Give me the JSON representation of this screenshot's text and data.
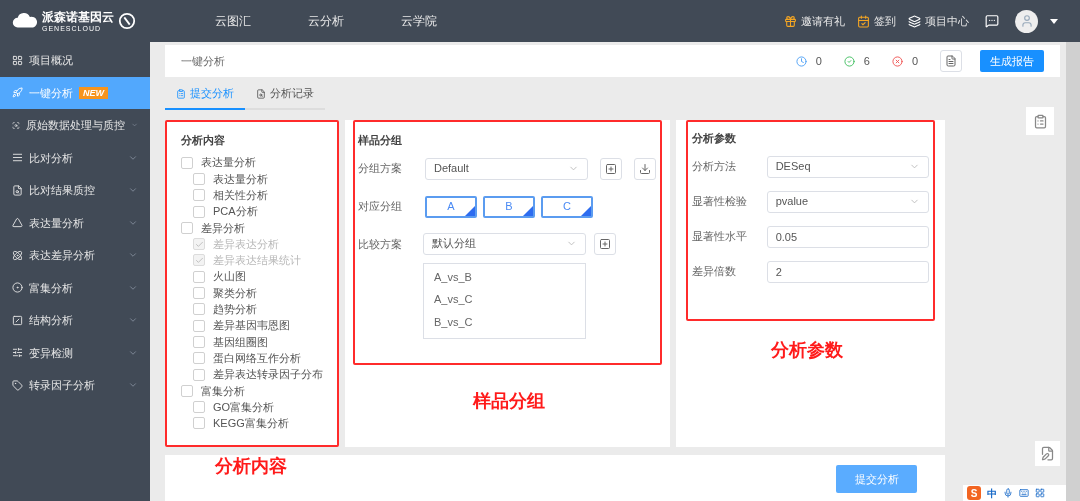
{
  "logo": {
    "name": "派森诺基因云",
    "subtitle": "GENESCLOUD"
  },
  "nav": [
    {
      "label": "云图汇"
    },
    {
      "label": "云分析"
    },
    {
      "label": "云学院"
    }
  ],
  "user_menu": [
    {
      "kind": "gift",
      "label": "邀请有礼"
    },
    {
      "kind": "sign",
      "label": "签到"
    },
    {
      "kind": "layers",
      "label": "项目中心"
    }
  ],
  "sidebar": [
    {
      "label": "项目概况",
      "selected": false,
      "expandable": false
    },
    {
      "label": "一键分析",
      "selected": true,
      "expandable": false,
      "badge": "NEW"
    },
    {
      "label": "原始数据处理与质控",
      "selected": false,
      "expandable": true
    },
    {
      "label": "比对分析",
      "selected": false,
      "expandable": true
    },
    {
      "label": "比对结果质控",
      "selected": false,
      "expandable": true
    },
    {
      "label": "表达量分析",
      "selected": false,
      "expandable": true
    },
    {
      "label": "表达差异分析",
      "selected": false,
      "expandable": true
    },
    {
      "label": "富集分析",
      "selected": false,
      "expandable": true
    },
    {
      "label": "结构分析",
      "selected": false,
      "expandable": true
    },
    {
      "label": "变异检测",
      "selected": false,
      "expandable": true
    },
    {
      "label": "转录因子分析",
      "selected": false,
      "expandable": true
    }
  ],
  "breadcrumb": "一键分析",
  "status": [
    {
      "kind": "pending",
      "count": "0"
    },
    {
      "kind": "success",
      "count": "6"
    },
    {
      "kind": "failed",
      "count": "0"
    }
  ],
  "report_button": "生成报告",
  "tabs": [
    {
      "label": "提交分析",
      "selected": true
    },
    {
      "label": "分析记录",
      "selected": false
    }
  ],
  "analysis_content": {
    "title": "分析内容",
    "annotation": "分析内容",
    "items": [
      {
        "label": "表达量分析",
        "checked": false,
        "disabled": false,
        "children": [
          {
            "label": "表达量分析",
            "checked": false,
            "disabled": false
          },
          {
            "label": "相关性分析",
            "checked": false,
            "disabled": false
          },
          {
            "label": "PCA分析",
            "checked": false,
            "disabled": false
          }
        ]
      },
      {
        "label": "差异分析",
        "checked": false,
        "disabled": false,
        "children": [
          {
            "label": "差异表达分析",
            "checked": true,
            "disabled": true
          },
          {
            "label": "差异表达结果统计",
            "checked": true,
            "disabled": true
          },
          {
            "label": "火山图",
            "checked": false,
            "disabled": false
          },
          {
            "label": "聚类分析",
            "checked": false,
            "disabled": false
          },
          {
            "label": "趋势分析",
            "checked": false,
            "disabled": false
          },
          {
            "label": "差异基因韦恩图",
            "checked": false,
            "disabled": false
          },
          {
            "label": "基因组圈图",
            "checked": false,
            "disabled": false
          },
          {
            "label": "蛋白网络互作分析",
            "checked": false,
            "disabled": false
          },
          {
            "label": "差异表达转录因子分布",
            "checked": false,
            "disabled": false
          }
        ]
      },
      {
        "label": "富集分析",
        "checked": false,
        "disabled": false,
        "children": [
          {
            "label": "GO富集分析",
            "checked": false,
            "disabled": false
          },
          {
            "label": "KEGG富集分析",
            "checked": false,
            "disabled": false
          }
        ]
      }
    ]
  },
  "sample_groups": {
    "title": "样品分组",
    "annotation": "样品分组",
    "scheme": {
      "label": "分组方案",
      "value": "Default"
    },
    "groups": {
      "label": "对应分组",
      "items": [
        {
          "label": "A"
        },
        {
          "label": "B"
        },
        {
          "label": "C"
        }
      ]
    },
    "comparison": {
      "label": "比较方案",
      "value": "默认分组",
      "pairs": [
        "A_vs_B",
        "A_vs_C",
        "B_vs_C"
      ]
    }
  },
  "parameters": {
    "title": "分析参数",
    "annotation": "分析参数",
    "fields": [
      {
        "kind": "select",
        "label": "分析方法",
        "value": "DESeq"
      },
      {
        "kind": "select",
        "label": "显著性检验",
        "value": "pvalue"
      },
      {
        "kind": "input",
        "label": "显著性水平",
        "value": "0.05"
      },
      {
        "kind": "input",
        "label": "差异倍数",
        "value": "2"
      }
    ]
  },
  "submit_button": "提交分析",
  "ime": {
    "logo": "S",
    "mode": "中"
  }
}
